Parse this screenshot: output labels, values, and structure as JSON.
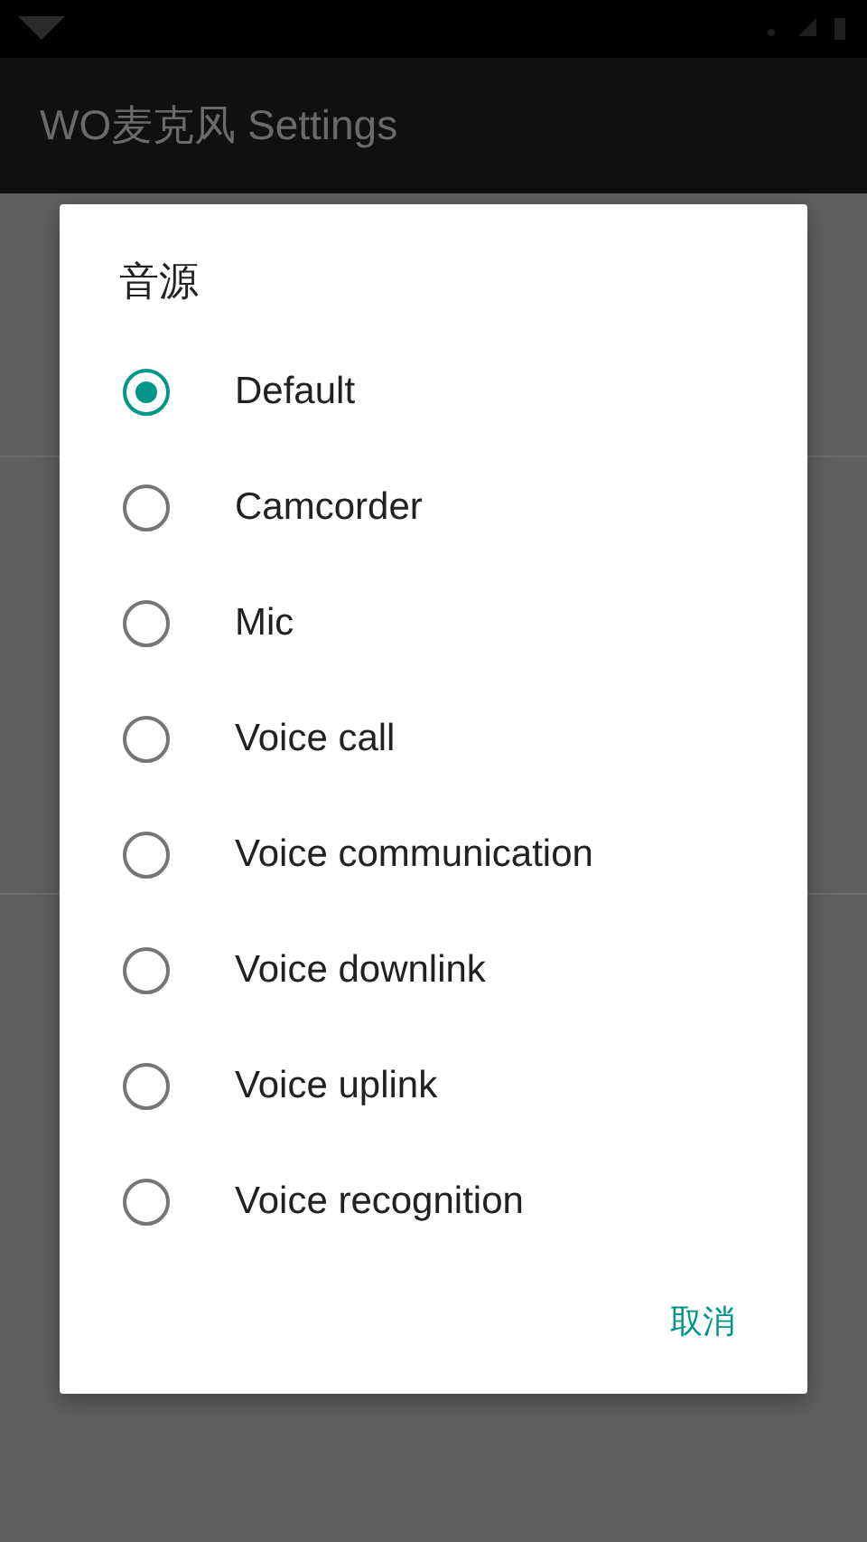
{
  "app_bar": {
    "title": "WO麦克风 Settings"
  },
  "dialog": {
    "title": "音源",
    "options": [
      {
        "label": "Default",
        "selected": true
      },
      {
        "label": "Camcorder",
        "selected": false
      },
      {
        "label": "Mic",
        "selected": false
      },
      {
        "label": "Voice call",
        "selected": false
      },
      {
        "label": "Voice communication",
        "selected": false
      },
      {
        "label": "Voice downlink",
        "selected": false
      },
      {
        "label": "Voice uplink",
        "selected": false
      },
      {
        "label": "Voice recognition",
        "selected": false
      }
    ],
    "cancel_button": "取消"
  }
}
